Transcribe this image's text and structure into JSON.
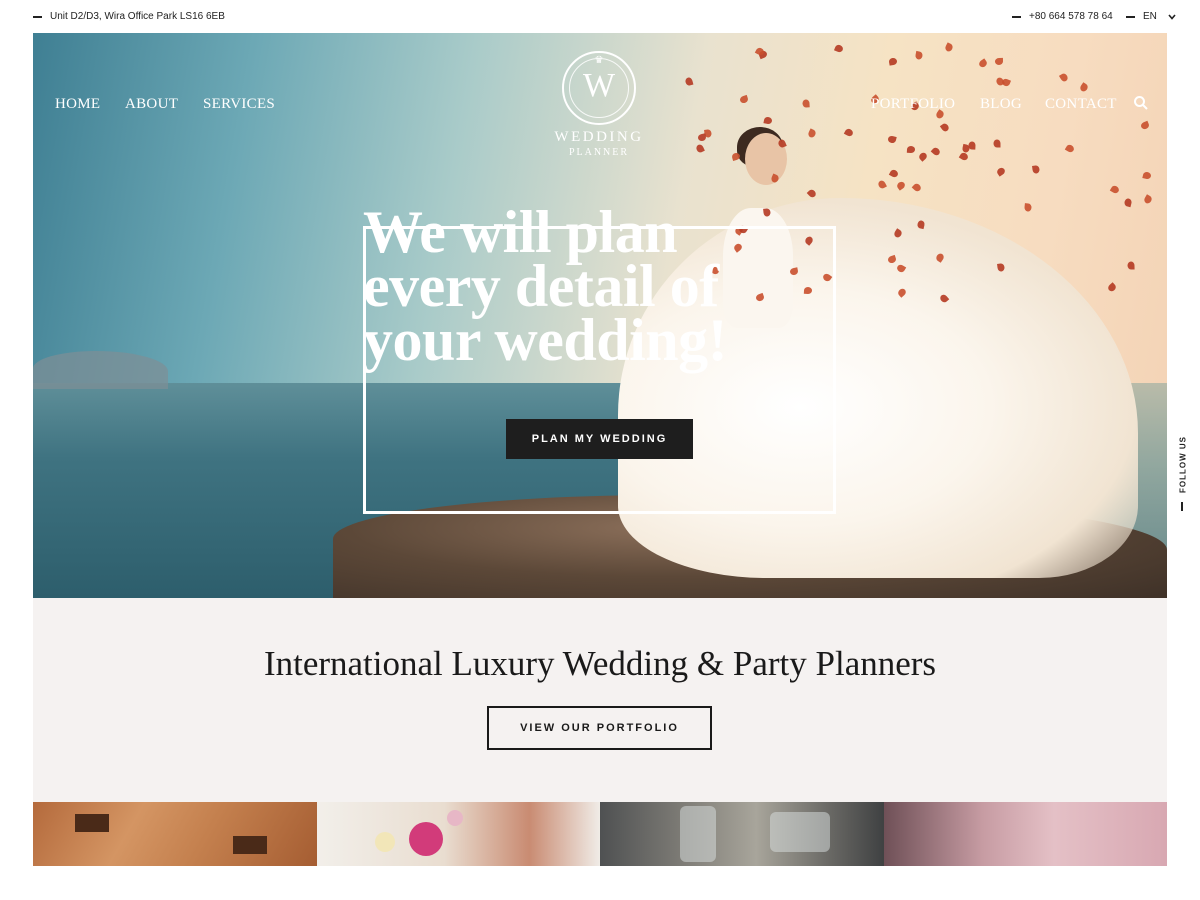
{
  "topbar": {
    "address": "Unit D2/D3, Wira Office Park LS16 6EB",
    "phone": "+80 664 578 78 64",
    "language": "EN"
  },
  "nav": {
    "left": [
      "HOME",
      "ABOUT",
      "SERVICES"
    ],
    "right": [
      "PORTFOLIO",
      "BLOG",
      "CONTACT"
    ]
  },
  "logo": {
    "letter": "W",
    "title": "WEDDING",
    "subtitle": "PLANNER"
  },
  "hero": {
    "title_lines": [
      "We will plan",
      "every detail of",
      "your wedding!"
    ],
    "button": "PLAN MY WEDDING"
  },
  "follow": {
    "label": "FOLLOW US"
  },
  "intro": {
    "title": "International Luxury Wedding & Party Planners",
    "button": "VIEW OUR PORTFOLIO"
  },
  "icons": {
    "search": "search-icon",
    "language_dropdown": "chevron-down-icon",
    "dash": "dash-icon"
  },
  "colors": {
    "button_dark": "#1e1e1e",
    "intro_background": "#f5f2f1",
    "text_dark": "#1a1a1a"
  }
}
